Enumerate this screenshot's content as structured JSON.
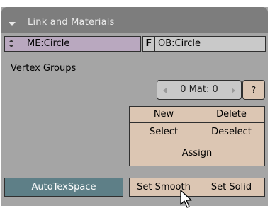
{
  "panel": {
    "title": "Link and Materials",
    "mesh_name": "ME:Circle",
    "fake_user_label": "F",
    "object_name": "OB:Circle",
    "vertex_groups_label": "Vertex Groups",
    "material_selector": "0 Mat: 0",
    "help_label": "?",
    "new_label": "New",
    "delete_label": "Delete",
    "select_label": "Select",
    "deselect_label": "Deselect",
    "assign_label": "Assign",
    "autotexspace_label": "AutoTexSpace",
    "set_smooth_label": "Set Smooth",
    "set_solid_label": "Set Solid"
  },
  "icons": {
    "collapse": "triangle-down-icon",
    "mesh_browse": "up-down-arrows-icon",
    "mat_prev": "left-arrow-icon",
    "mat_next": "right-arrow-icon",
    "cursor": "mouse-pointer-icon"
  },
  "colors": {
    "panel_bg": "#a5a5a5",
    "header_bg": "#7d7d7d",
    "mesh_field": "#b9a8bf",
    "button": "#dcc6b3",
    "active_toggle": "#5e7f87"
  }
}
